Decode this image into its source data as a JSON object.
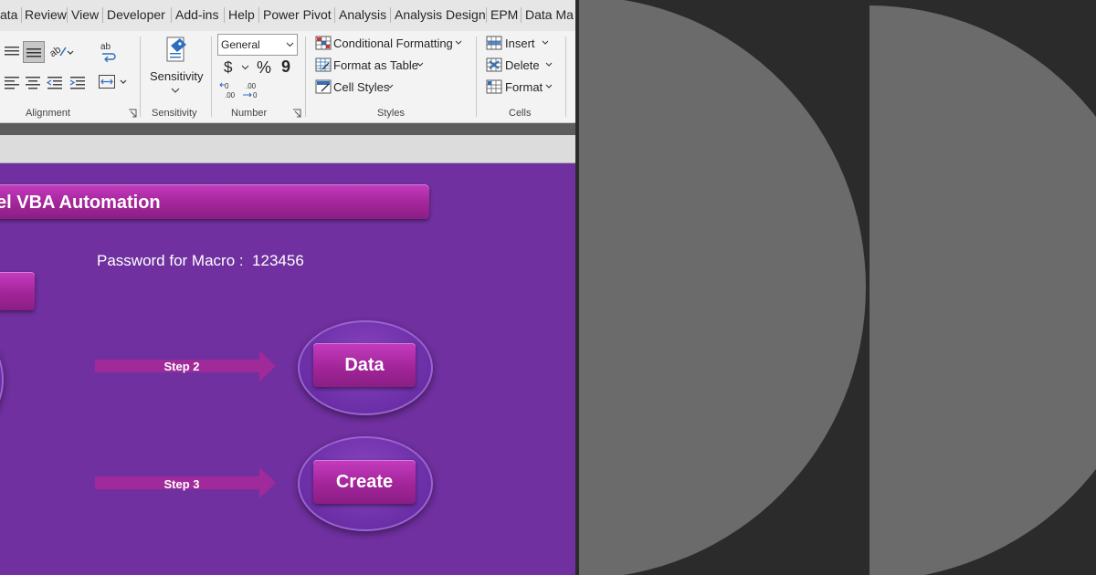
{
  "menu_tabs": [
    "ata",
    "Review",
    "View",
    "Developer",
    "Add-ins",
    "Help",
    "Power Pivot",
    "Analysis",
    "Analysis Design",
    "EPM",
    "Data Ma"
  ],
  "ribbon": {
    "alignment": {
      "label": "Alignment"
    },
    "sensitivity": {
      "button_label": "Sensitivity",
      "label": "Sensitivity"
    },
    "number": {
      "format_value": "General",
      "currency": "$",
      "percent": "%",
      "comma": "9",
      "label": "Number"
    },
    "styles": {
      "conditional_formatting": "Conditional Formatting",
      "format_as_table": "Format as Table",
      "cell_styles": "Cell Styles",
      "label": "Styles"
    },
    "cells": {
      "insert": "Insert",
      "delete": "Delete",
      "format": "Format",
      "label": "Cells"
    }
  },
  "sheet": {
    "title_banner": "el VBA Automation",
    "password_text": "Password for Macro :  123456",
    "step2_label": "Step 2",
    "step3_label": "Step 3",
    "data_button": "Data",
    "create_button": "Create"
  },
  "colors": {
    "sheet_background": "#7030a0",
    "button_magenta": "#a32599",
    "panel_circle": "#6b6b6b",
    "panel_background": "#2b2b2b"
  }
}
